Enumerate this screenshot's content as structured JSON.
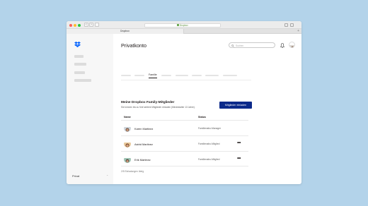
{
  "browser": {
    "url": "Dropbox",
    "tab_title": "Dropbox",
    "new_tab": "+",
    "back": "‹",
    "forward": "›"
  },
  "sidebar": {
    "footer_label": "Privat",
    "footer_chevron": "⌃"
  },
  "header": {
    "title": "Privatkonto",
    "search_placeholder": "Suchen"
  },
  "tabs": {
    "active_label": "Familie"
  },
  "family": {
    "heading": "Meine Dropbox Family-Mitglieder",
    "subtext": "Sie können bis zu fünf weitere Mitglieder einladen (Mindestalter 13 Jahre).",
    "invite_button": "Mitglieder einladen",
    "columns": {
      "name": "Name",
      "status": "Status"
    },
    "members": [
      {
        "name": "Karen Martinez",
        "status": "Familienabo-Manager",
        "avatar": "woman-avatar"
      },
      {
        "name": "Astrid Martinez",
        "status": "Familienabo-Mitglied",
        "avatar": "girl-avatar",
        "more": "•••"
      },
      {
        "name": "Erik Martinez",
        "status": "Familienabo-Mitglied",
        "avatar": "boy-avatar",
        "more": "•••"
      }
    ],
    "invites_left": "2/5 Einladungen übrig"
  },
  "colors": {
    "accent": "#0c2a8a",
    "brand": "#0061fe",
    "background": "#b3d3ea"
  }
}
